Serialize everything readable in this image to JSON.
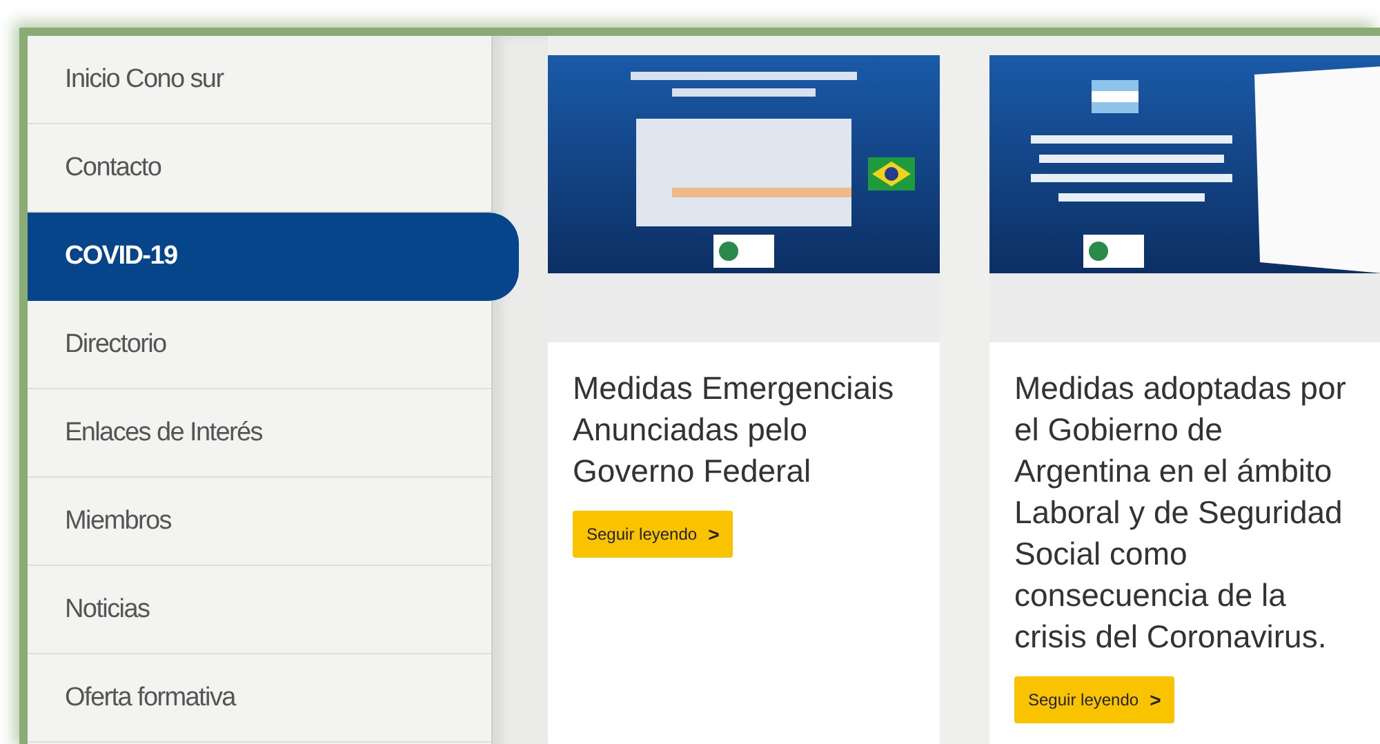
{
  "sidebar": {
    "items": [
      {
        "label": "Inicio Cono sur",
        "selected": false
      },
      {
        "label": "Contacto",
        "selected": false
      },
      {
        "label": "COVID-19",
        "selected": true
      },
      {
        "label": "Directorio",
        "selected": false
      },
      {
        "label": "Enlaces de Interés",
        "selected": false
      },
      {
        "label": "Miembros",
        "selected": false
      },
      {
        "label": "Noticias",
        "selected": false
      },
      {
        "label": "Oferta formativa",
        "selected": false
      }
    ]
  },
  "cards": [
    {
      "title": "Medidas Emergenciais Anunciadas pelo Governo Federal",
      "button": "Seguir leyendo",
      "arrow": ">"
    },
    {
      "title": "Medidas adoptadas por el Gobierno de Argentina en el ámbito Laboral y de Seguridad Social como consecuencia de la crisis del Coronavirus.",
      "button": "Seguir leyendo",
      "arrow": ">"
    }
  ]
}
